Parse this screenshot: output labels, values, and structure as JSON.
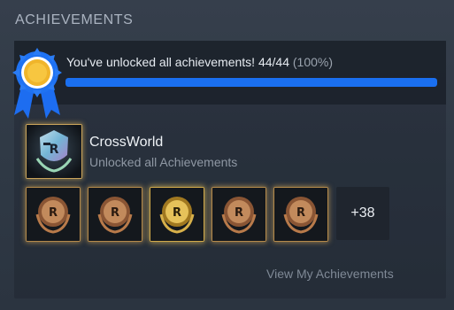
{
  "section": {
    "title": "ACHIEVEMENTS"
  },
  "progress": {
    "text": "You've unlocked all achievements! 44/44",
    "percent_text": "(100%)",
    "unlocked": 44,
    "total": 44,
    "fill_fraction": 1.0,
    "bar_color": "#1a6ff0",
    "ribbon_icon": "award-ribbon-icon"
  },
  "game": {
    "name": "CrossWorld",
    "subtitle": "Unlocked all Achievements",
    "icon": "crossworld-logo-icon"
  },
  "achievements": {
    "badges": [
      {
        "icon": "bronze-laurel-badge-icon",
        "tone": "bronze"
      },
      {
        "icon": "bronze-laurel-badge-icon",
        "tone": "bronze"
      },
      {
        "icon": "gold-laurel-badge-icon",
        "tone": "gold"
      },
      {
        "icon": "bronze-laurel-badge-icon",
        "tone": "bronze"
      },
      {
        "icon": "bronze-laurel-badge-icon",
        "tone": "bronze"
      }
    ],
    "more_label": "+38"
  },
  "footer": {
    "view_link": "View My Achievements"
  },
  "colors": {
    "accent": "#1a6ff0",
    "gold": "#e5b85a",
    "bronze": "#b9764a"
  }
}
